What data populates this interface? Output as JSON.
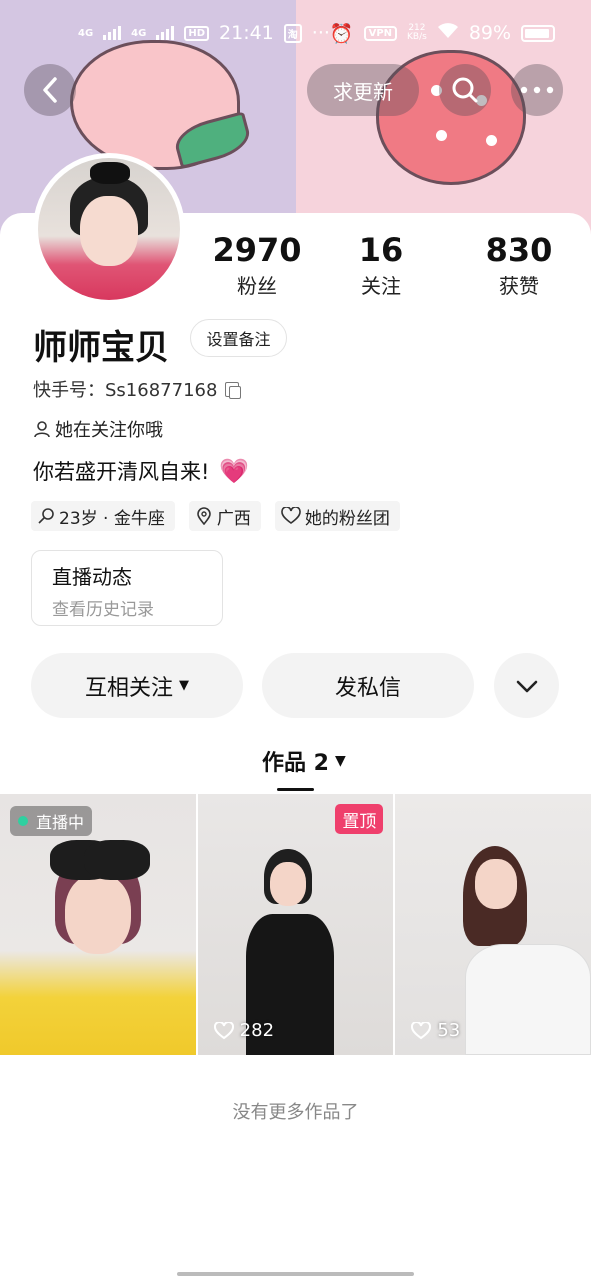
{
  "status_bar": {
    "signal_1": "4G",
    "signal_2": "4G",
    "hd": "HD",
    "time": "21:41",
    "app_badge": "淘",
    "more": "···",
    "vpn": "VPN",
    "speed_value": "212",
    "speed_unit": "KB/s",
    "battery": "89%"
  },
  "nav": {
    "update_label": "求更新"
  },
  "profile": {
    "name": "师师宝贝",
    "remark_label": "设置备注",
    "kuaishou_id": "快手号：Ss16877168",
    "follow_note": "她在关注你哦",
    "bio": "你若盛开清风自来!",
    "bio_emoji": "💗"
  },
  "stats": [
    {
      "value": "2970",
      "label": "粉丝"
    },
    {
      "value": "16",
      "label": "关注"
    },
    {
      "value": "830",
      "label": "获赞"
    }
  ],
  "tags": [
    {
      "text": "23岁 · 金牛座"
    },
    {
      "text": "广西"
    },
    {
      "text": "她的粉丝团"
    }
  ],
  "live_card": {
    "title": "直播动态",
    "subtitle": "查看历史记录"
  },
  "actions": {
    "follow_label": "互相关注",
    "message_label": "发私信"
  },
  "works_tab": {
    "label": "作品 2"
  },
  "works": [
    {
      "badge": "直播中"
    },
    {
      "badge": "置顶",
      "likes": "282"
    },
    {
      "likes": "53"
    }
  ],
  "footer": {
    "no_more": "没有更多作品了"
  }
}
